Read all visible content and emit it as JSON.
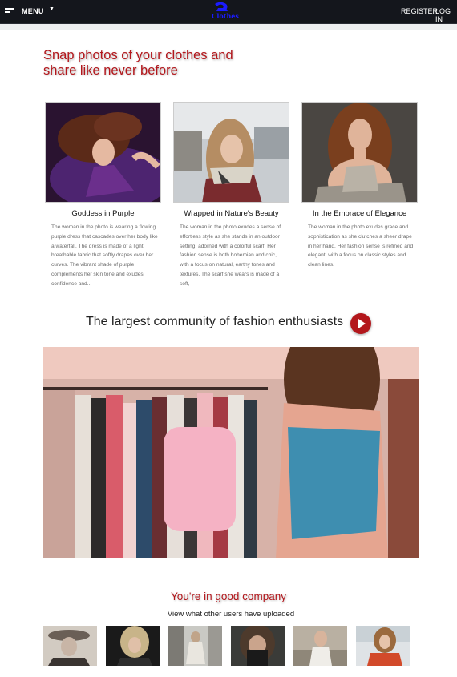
{
  "nav": {
    "menu_label": "MENU",
    "logo_text": "Clothes",
    "register_label": "REGISTER",
    "login_label": "LOG IN"
  },
  "hero": {
    "title": "Snap photos of your clothes and share like never before"
  },
  "cards": [
    {
      "caption": "Goddess in Purple",
      "description": "The woman in the photo is wearing a flowing purple dress that cascades over her body like a waterfall. The dress is made of a light, breathable fabric that softly drapes over her curves. The vibrant shade of purple complements her skin tone and exudes confidence and..."
    },
    {
      "caption": "Wrapped in Nature's Beauty",
      "description": "The woman in the photo exudes a sense of effortless style as she stands in an outdoor setting, adorned with a colorful scarf. Her fashion sense is both bohemian and chic, with a focus on natural, earthy tones and textures. The scarf she wears is made of a soft,"
    },
    {
      "caption": "In the Embrace of Elegance",
      "description": "The woman in the photo exudes grace and sophistication as she clutches a sheer drape in her hand. Her fashion sense is refined and elegant, with a focus on classic styles and clean lines."
    }
  ],
  "community": {
    "heading": "The largest community of fashion enthusiasts"
  },
  "company": {
    "heading": "You're in good company",
    "subheading": "View what other users have uploaded"
  },
  "colors": {
    "accent": "#b3171c",
    "navbar": "#14161c",
    "logo": "#1b1bff"
  },
  "icons": {
    "menu": "hamburger-icon",
    "caret": "caret-down-icon",
    "play": "play-icon"
  }
}
